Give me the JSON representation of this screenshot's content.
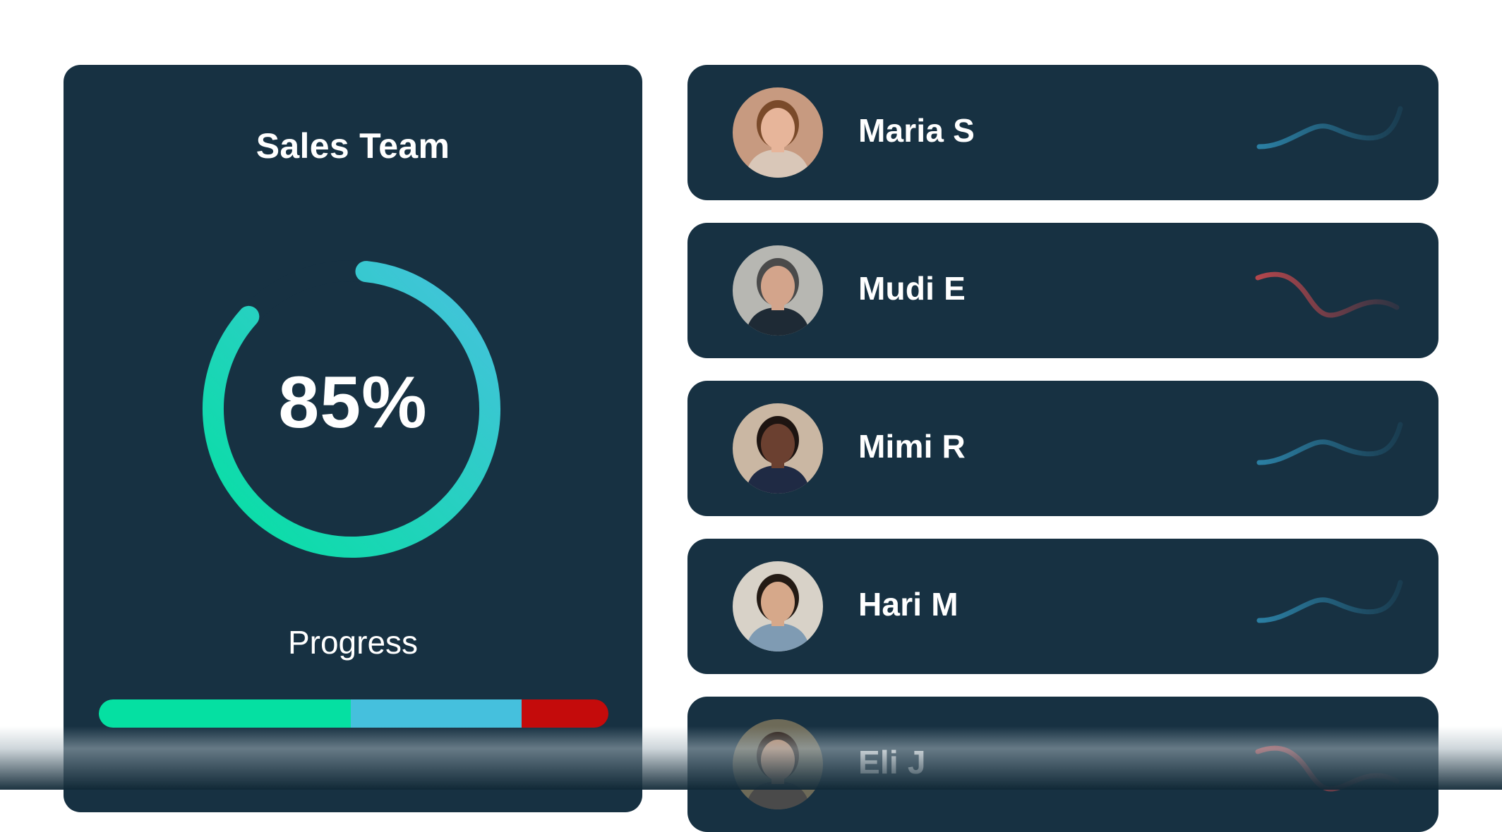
{
  "team": {
    "title": "Sales Team",
    "progress_value": "85%",
    "progress_fraction": 0.85,
    "progress_label": "Progress",
    "progress_segments": [
      {
        "fraction": 0.495,
        "color": "#05e0a2"
      },
      {
        "fraction": 0.335,
        "color": "#45c0dd"
      },
      {
        "fraction": 0.17,
        "color": "#c40b0b"
      }
    ],
    "ring_colors": {
      "start": "#05e0a2",
      "end": "#47c1de"
    }
  },
  "members": [
    {
      "name": "Maria S",
      "trend": "up",
      "trend_color": "#2b7fa3",
      "avatar_icon": "avatar-photo-icon"
    },
    {
      "name": "Mudi E",
      "trend": "down",
      "trend_color": "#b2464c",
      "avatar_icon": "avatar-photo-icon"
    },
    {
      "name": "Mimi R",
      "trend": "up",
      "trend_color": "#2b7fa3",
      "avatar_icon": "avatar-photo-icon"
    },
    {
      "name": "Hari M",
      "trend": "up",
      "trend_color": "#2b7fa3",
      "avatar_icon": "avatar-photo-icon"
    },
    {
      "name": "Eli J",
      "trend": "down",
      "trend_color": "#b2464c",
      "avatar_icon": "avatar-photo-icon"
    }
  ]
}
